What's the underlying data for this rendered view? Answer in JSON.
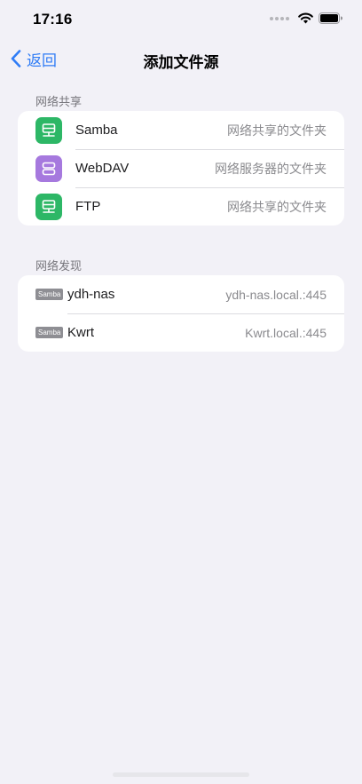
{
  "status": {
    "time": "17:16"
  },
  "nav": {
    "back_label": "返回",
    "title": "添加文件源"
  },
  "sections": {
    "share_header": "网络共享",
    "discovery_header": "网络发现"
  },
  "share_items": [
    {
      "title": "Samba",
      "detail": "网络共享的文件夹",
      "icon": "server-icon",
      "color": "#2DB766"
    },
    {
      "title": "WebDAV",
      "detail": "网络服务器的文件夹",
      "icon": "server-stack-icon",
      "color": "#A679DE"
    },
    {
      "title": "FTP",
      "detail": "网络共享的文件夹",
      "icon": "server-icon",
      "color": "#2DB766"
    }
  ],
  "discovered": [
    {
      "tag": "Samba",
      "name": "ydh-nas",
      "address": "ydh-nas.local.:445"
    },
    {
      "tag": "Samba",
      "name": "Kwrt",
      "address": "Kwrt.local.:445"
    }
  ]
}
